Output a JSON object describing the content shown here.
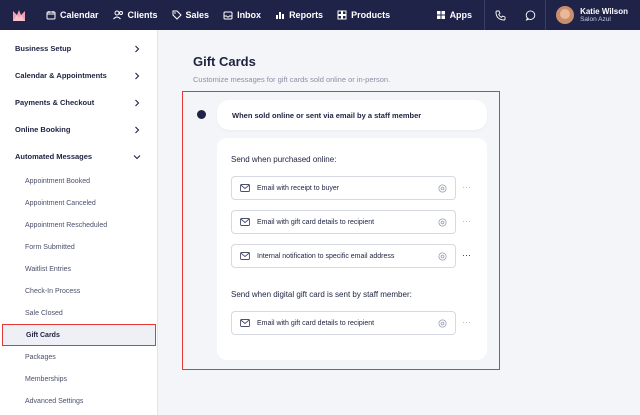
{
  "topnav": {
    "items": [
      {
        "label": "Calendar",
        "icon": "calendar-icon"
      },
      {
        "label": "Clients",
        "icon": "clients-icon"
      },
      {
        "label": "Sales",
        "icon": "tag-icon"
      },
      {
        "label": "Inbox",
        "icon": "inbox-icon"
      },
      {
        "label": "Reports",
        "icon": "reports-icon"
      },
      {
        "label": "Products",
        "icon": "products-icon"
      }
    ],
    "apps_label": "Apps",
    "user": {
      "name": "Katie Wilson",
      "business": "Salon Azul"
    }
  },
  "sidebar": {
    "sections": [
      {
        "label": "Business Setup"
      },
      {
        "label": "Calendar & Appointments"
      },
      {
        "label": "Payments & Checkout"
      },
      {
        "label": "Online Booking"
      },
      {
        "label": "Automated Messages"
      }
    ],
    "sub_items": [
      {
        "label": "Appointment Booked"
      },
      {
        "label": "Appointment Canceled"
      },
      {
        "label": "Appointment Rescheduled"
      },
      {
        "label": "Form Submitted"
      },
      {
        "label": "Waitlist Entries"
      },
      {
        "label": "Check-In Process"
      },
      {
        "label": "Sale Closed"
      },
      {
        "label": "Gift Cards"
      },
      {
        "label": "Packages"
      },
      {
        "label": "Memberships"
      },
      {
        "label": "Advanced Settings"
      }
    ],
    "active_item": "Gift Cards"
  },
  "main": {
    "title": "Gift Cards",
    "description": "Customize messages for gift cards sold online or in-person.",
    "option_label": "When sold online or sent via email by a staff member",
    "groups": [
      {
        "label": "Send when purchased online:",
        "fields": [
          {
            "label": "Email with receipt to buyer"
          },
          {
            "label": "Email with gift card details to recipient"
          },
          {
            "label": "Internal notification to specific email address"
          }
        ]
      },
      {
        "label": "Send when digital gift card is sent by staff member:",
        "fields": [
          {
            "label": "Email with gift card details to recipient"
          }
        ]
      }
    ]
  },
  "colors": {
    "nav_bg": "#1f2347",
    "highlight": "#e53935",
    "text_dark": "#1d2240"
  }
}
